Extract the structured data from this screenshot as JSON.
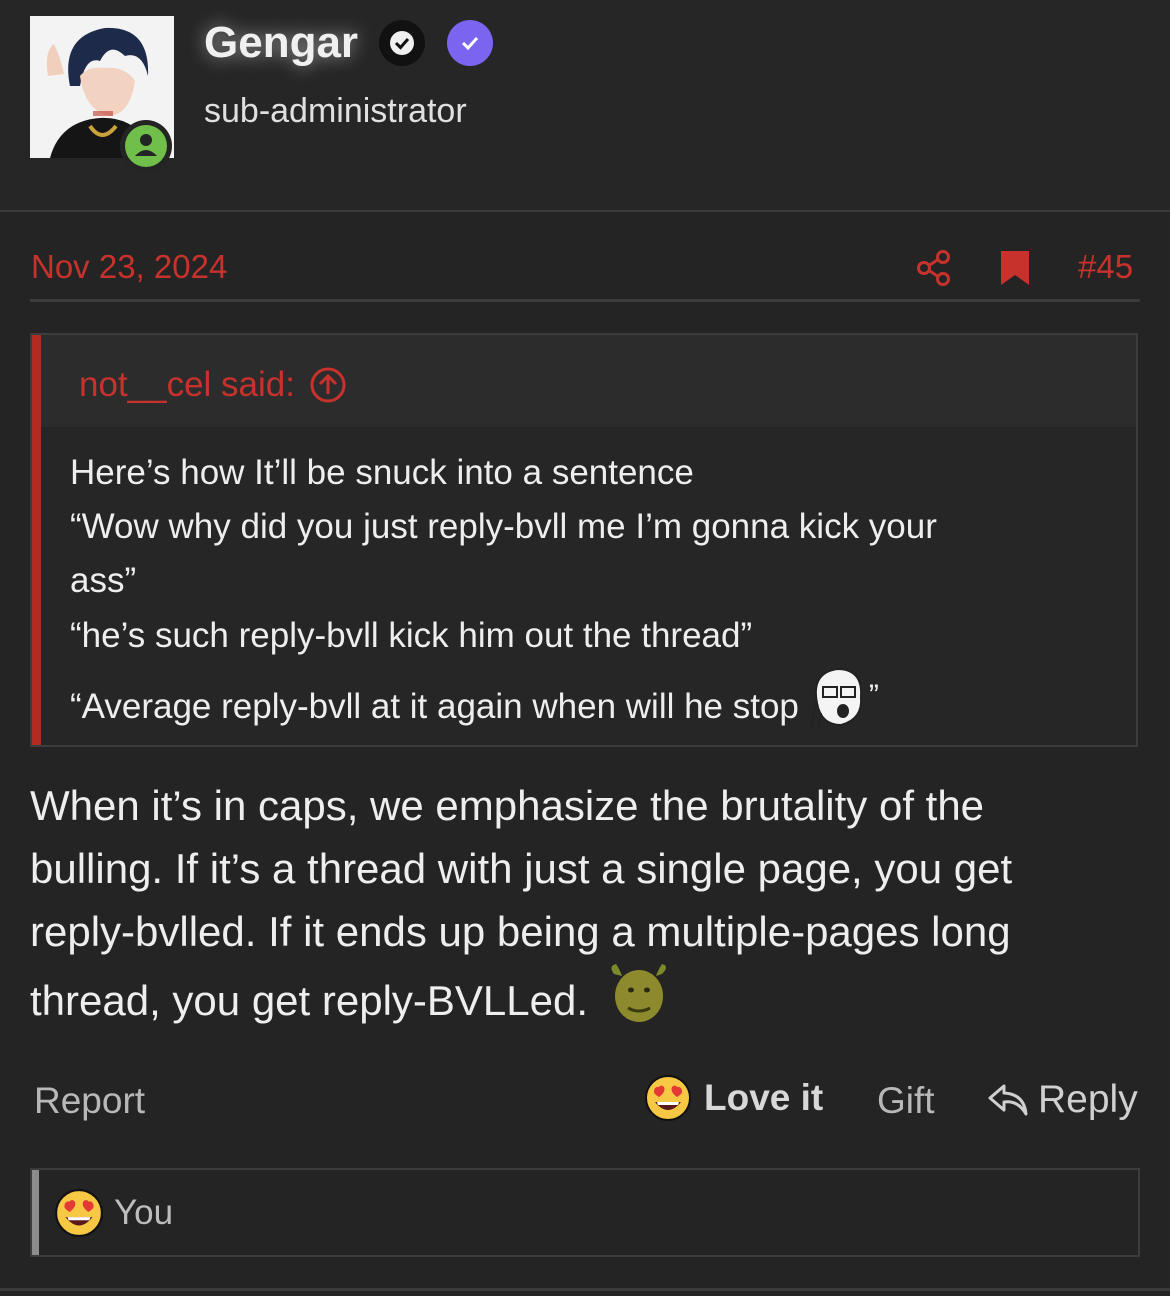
{
  "user": {
    "name": "Gengar",
    "title": "sub-administrator",
    "status": "online"
  },
  "post": {
    "date": "Nov 23, 2024",
    "number": "#45"
  },
  "quote": {
    "author": "not__cel said:",
    "lines": [
      "Here’s how It’ll be snuck into a sentence",
      "“Wow why did you just reply-bvll me I’m gonna kick your",
      "ass”",
      "“he’s such reply-bvll kick him out the thread”",
      "“Average reply-bvll at it again when will he stop",
      "”"
    ]
  },
  "body": {
    "lines": [
      "When it’s in caps, we emphasize the brutality of the",
      "bulling. If it’s a thread with just a single page, you get",
      "reply-bvlled. If it ends up being a multiple-pages long",
      "thread, you get reply-BVLLed."
    ]
  },
  "actions": {
    "report": "Report",
    "love": "Love it",
    "gift": "Gift",
    "reply": "Reply"
  },
  "reactions": {
    "user": "You"
  },
  "colors": {
    "accent_red": "#c8322c",
    "verified_purple": "#7b64f0",
    "online_green": "#6fbf4a",
    "background": "#242424"
  },
  "icons": [
    "share-icon",
    "bookmark-icon",
    "arrow-up-circle-icon",
    "reply-icon",
    "heart-eyes-emoji",
    "soyjak-emoji",
    "shrek-emoji",
    "checkmark-icon",
    "user-online-icon"
  ]
}
